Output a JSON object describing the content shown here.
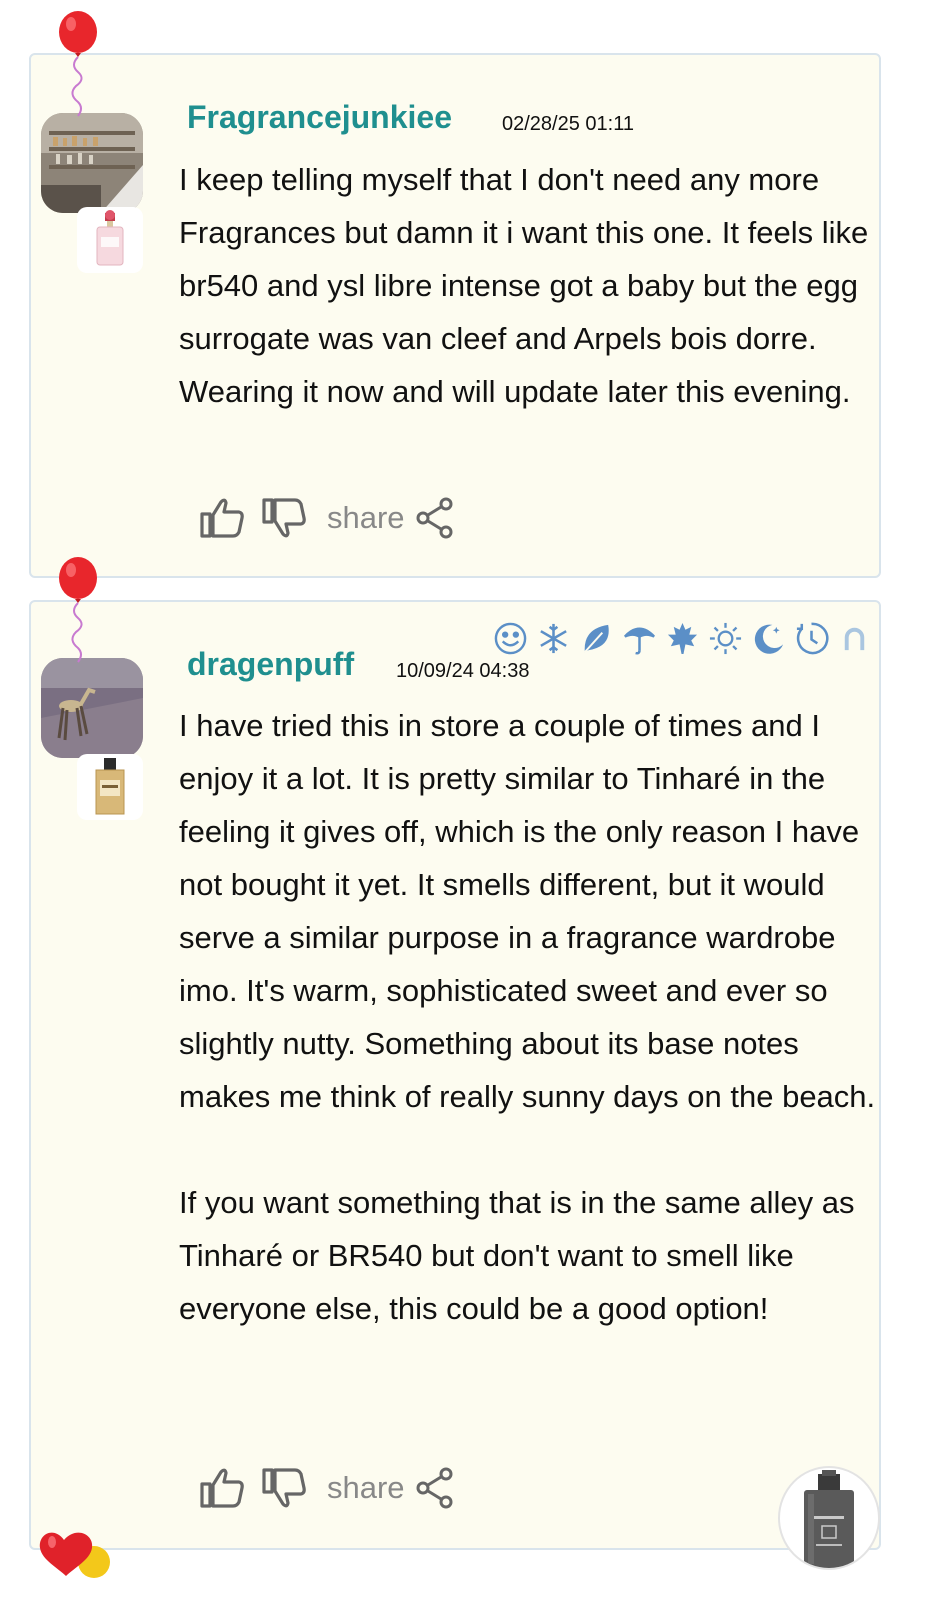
{
  "reviews": [
    {
      "username": "Fragrancejunkiee",
      "date": "02/28/25 01:11",
      "paragraphs": [
        "I keep telling myself that I don't need any more Fragrances but damn it i want this one. It feels like br540 and ysl libre intense got a baby but the egg surrogate was van cleef and Arpels bois dorre. Wearing it now and will update later this evening."
      ],
      "share_label": "share"
    },
    {
      "username": "dragenpuff",
      "date": "10/09/24 04:38",
      "paragraphs": [
        "I have tried this in store a couple of times and I enjoy it a lot. It is pretty similar to Tinharé in the feeling it gives off, which is the only reason I have not bought it yet. It smells different, but it would serve a similar purpose in a fragrance wardrobe imo. It's warm, sophisticated sweet and ever so slightly nutty. Something about its base notes makes me think of really sunny days on the beach.",
        "If you want something that is in the same alley as Tinharé or BR540 but don't want to smell like everyone else, this could be a good option!"
      ],
      "share_label": "share",
      "season_icons": [
        "smiley-icon",
        "snowflake-icon",
        "leaf-icon",
        "umbrella-icon",
        "maple-leaf-icon",
        "sun-icon",
        "moon-icon",
        "clock-icon",
        "horseshoe-icon"
      ]
    }
  ],
  "colors": {
    "username": "#1f8f8f",
    "card_background": "#fdfcf0",
    "card_border": "#d9e4ec",
    "icon_blue": "#5b8fc7",
    "icon_gray": "#666666"
  }
}
